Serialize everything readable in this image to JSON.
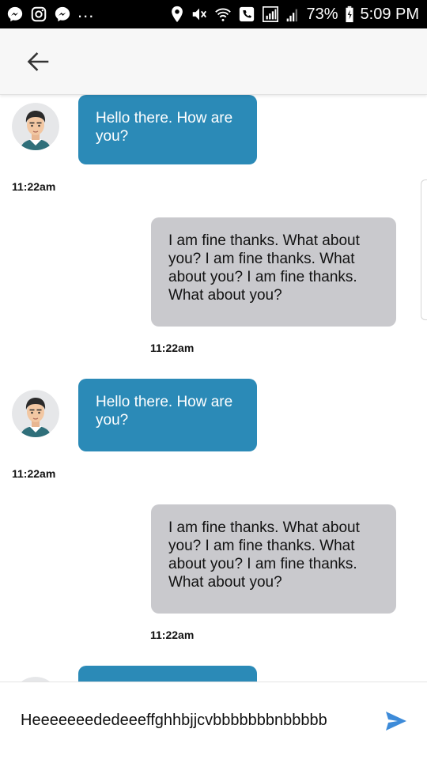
{
  "status_bar": {
    "battery": "73%",
    "time": "5:09 PM",
    "overflow": "...",
    "left_icons": [
      "messenger-icon",
      "instagram-icon",
      "messenger-icon"
    ],
    "right_icons": [
      "location-icon",
      "mute-icon",
      "wifi-calling-icon",
      "call-icon",
      "signal-icon",
      "signal-icon",
      "battery-icon"
    ]
  },
  "app_bar": {
    "back_icon": "arrow-left-icon"
  },
  "messages": [
    {
      "direction": "incoming",
      "text": "Hello there. How are you?",
      "time": "11:22am"
    },
    {
      "direction": "outgoing",
      "text": "I am fine thanks. What about you? I am fine thanks. What about you? I am fine thanks. What about you?",
      "time": "11:22am"
    },
    {
      "direction": "incoming",
      "text": "Hello there. How are you?",
      "time": "11:22am"
    },
    {
      "direction": "outgoing",
      "text": "I am fine thanks. What about you? I am fine thanks. What about you? I am fine thanks. What about you?",
      "time": "11:22am"
    },
    {
      "direction": "incoming",
      "text": "",
      "time": ""
    }
  ],
  "composer": {
    "value": "Heeeeeeededeeeffghhbjjcvbbbbbbbnbbbbb",
    "send_icon": "send-icon"
  },
  "colors": {
    "incoming_bubble": "#2b8ab7",
    "outgoing_bubble": "#c9c9cd",
    "send_icon": "#3d8bd9"
  }
}
